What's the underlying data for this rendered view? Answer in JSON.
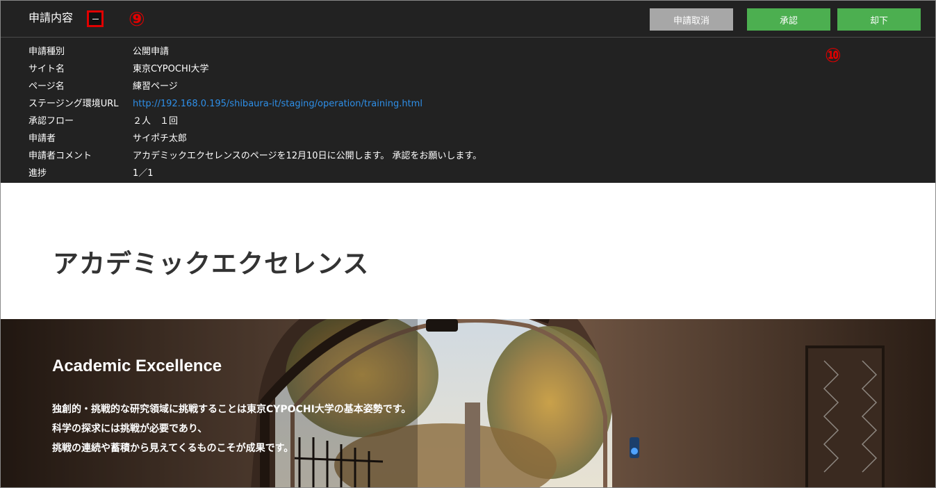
{
  "panel": {
    "title": "申請内容",
    "collapse_glyph": "－",
    "buttons": {
      "cancel": "申請取消",
      "approve": "承認",
      "reject": "却下"
    },
    "annotations": {
      "marker_9": "⑨",
      "marker_10": "⑩"
    },
    "info": [
      {
        "label": "申請種別",
        "value": "公開申請"
      },
      {
        "label": "サイト名",
        "value": "東京CYPOCHI大学"
      },
      {
        "label": "ページ名",
        "value": "練習ページ"
      },
      {
        "label": "ステージング環境URL",
        "value": "http://192.168.0.195/shibaura-it/staging/operation/training.html"
      },
      {
        "label": "承認フロー",
        "value": "２人　１回"
      },
      {
        "label": "申請者",
        "value": "サイポチ太郎"
      },
      {
        "label": "申請者コメント",
        "value": "アカデミックエクセレンスのページを12月10日に公開します。 承認をお願いします。"
      },
      {
        "label": "進捗",
        "value": "1／1"
      }
    ]
  },
  "preview": {
    "heading": "アカデミックエクセレンス",
    "hero": {
      "title": "Academic Excellence",
      "lines": [
        "独創的・挑戦的な研究領域に挑戦することは東京CYPOCHI大学の基本姿勢です。",
        "科学の探求には挑戦が必要であり、",
        "挑戦の連続や蓄積から見えてくるものこそが成果です。"
      ]
    }
  },
  "colors": {
    "panel_bg": "#222222",
    "button_green": "#4caf50",
    "button_gray": "#a7a7a7",
    "link_blue": "#2e8fe8",
    "annotation_red": "#e00000"
  }
}
